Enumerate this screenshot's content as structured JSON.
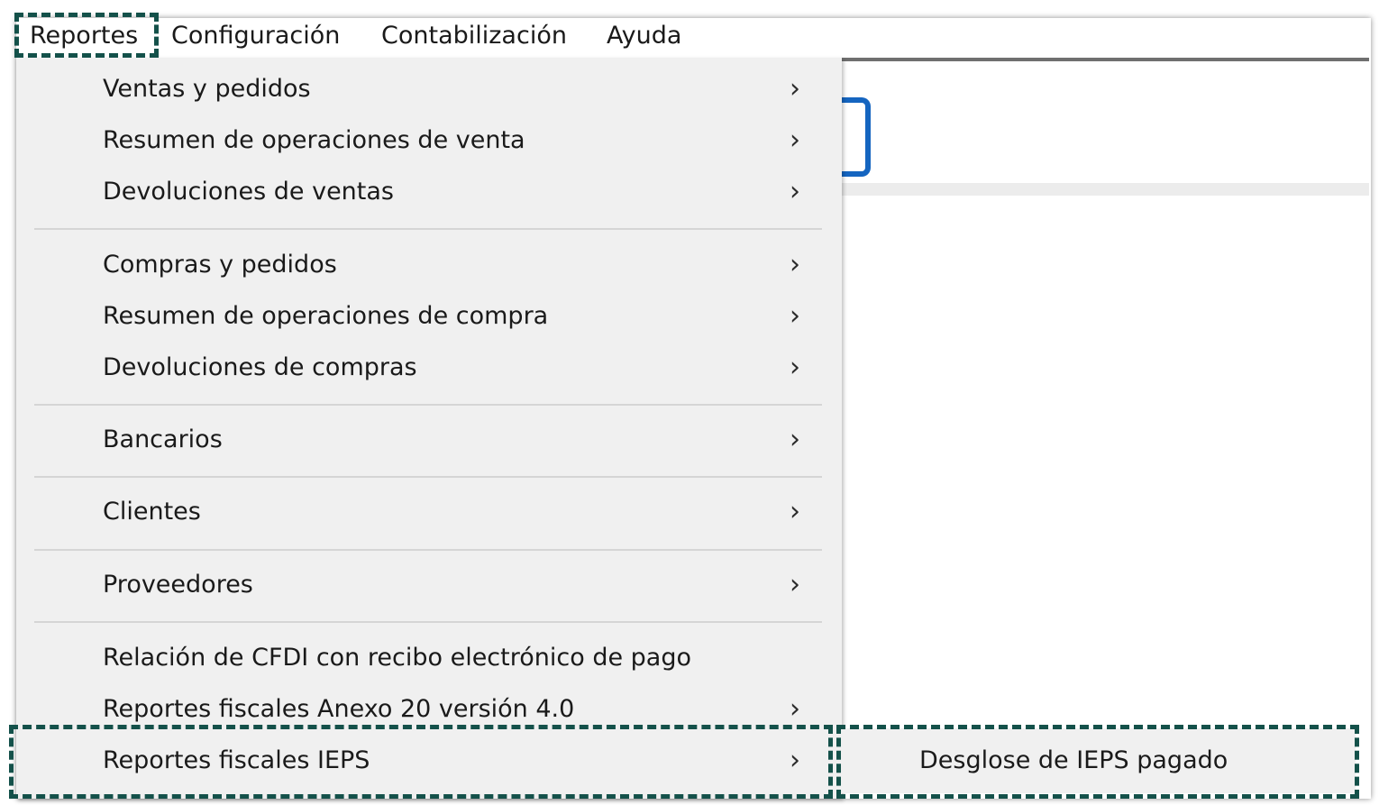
{
  "menubar": {
    "items": [
      {
        "label": "Reportes"
      },
      {
        "label": "Configuración"
      },
      {
        "label": "Contabilización"
      },
      {
        "label": "Ayuda"
      }
    ]
  },
  "reportes_menu": {
    "items": [
      {
        "label": "Ventas y pedidos",
        "submenu": true
      },
      {
        "label": "Resumen de operaciones de venta",
        "submenu": true
      },
      {
        "label": "Devoluciones de ventas",
        "submenu": true
      },
      {
        "label": "Compras y pedidos",
        "submenu": true
      },
      {
        "label": "Resumen de operaciones de compra",
        "submenu": true
      },
      {
        "label": "Devoluciones de compras",
        "submenu": true
      },
      {
        "label": "Bancarios",
        "submenu": true
      },
      {
        "label": "Clientes",
        "submenu": true
      },
      {
        "label": "Proveedores",
        "submenu": true
      },
      {
        "label": "Relación de CFDI con recibo electrónico de pago",
        "submenu": false
      },
      {
        "label": "Reportes fiscales Anexo 20 versión 4.0",
        "submenu": true
      },
      {
        "label": "Reportes fiscales IEPS",
        "submenu": true
      }
    ],
    "arrow_glyph": "›"
  },
  "ieps_submenu": {
    "items": [
      {
        "label": "Desglose de IEPS pagado"
      }
    ]
  },
  "colors": {
    "highlight_border": "#14514a",
    "menu_background": "#f0f0f0",
    "icon_accent": "#1565c0"
  },
  "icons": {
    "submenu_arrow": "chevron-right-icon"
  }
}
